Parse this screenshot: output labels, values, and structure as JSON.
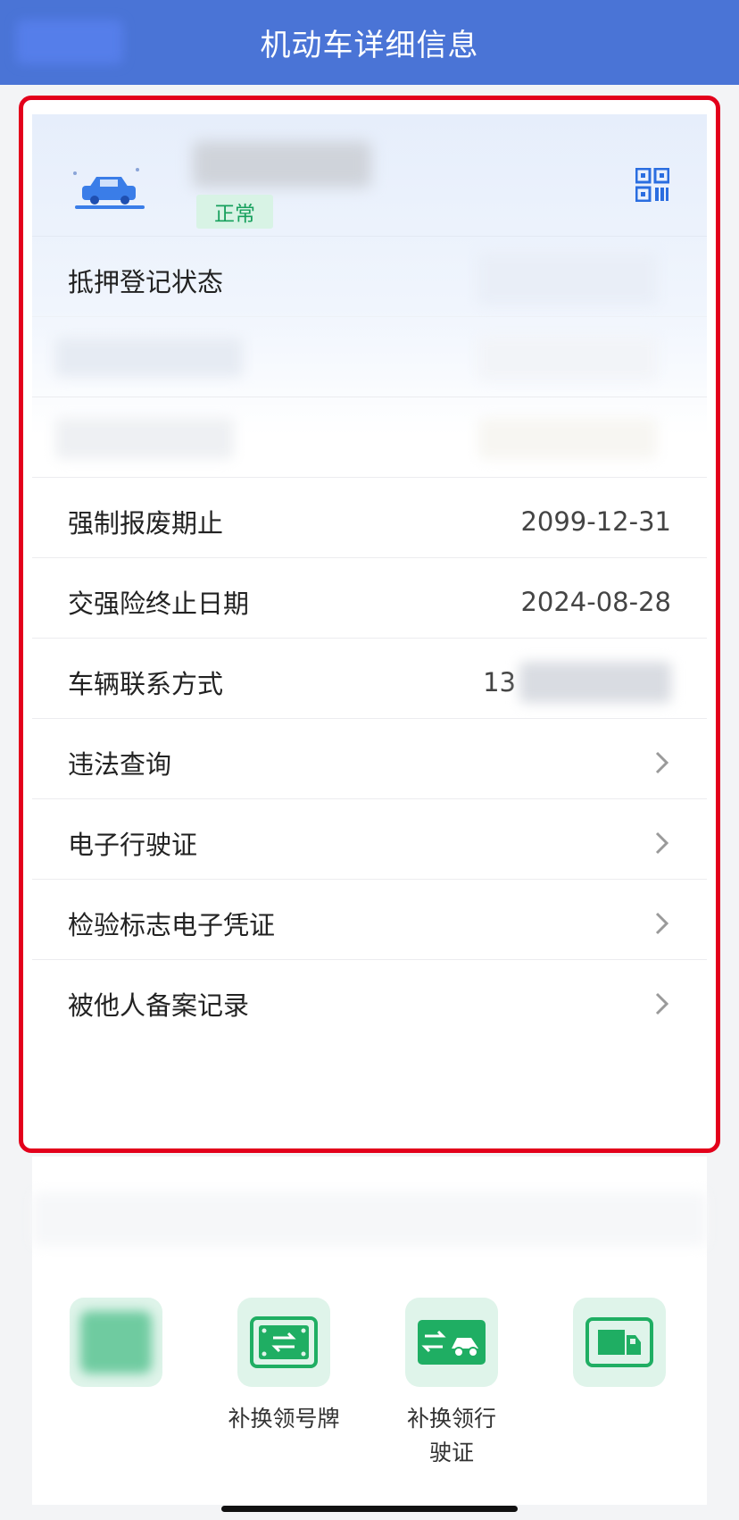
{
  "header": {
    "title": "机动车详细信息"
  },
  "vehicle": {
    "status_badge": "正常"
  },
  "rows": [
    {
      "label": "抵押登记状态",
      "value": ""
    },
    {
      "label": "强制报废期止",
      "value": "2099-12-31"
    },
    {
      "label": "交强险终止日期",
      "value": "2024-08-28"
    },
    {
      "label": "车辆联系方式",
      "value_prefix": "13"
    },
    {
      "label": "违法查询"
    },
    {
      "label": "电子行驶证"
    },
    {
      "label": "检验标志电子凭证"
    },
    {
      "label": "被他人备案记录"
    }
  ],
  "services": [
    {
      "label": ""
    },
    {
      "label": "补换领号牌"
    },
    {
      "label": "补换领行\n驶证"
    },
    {
      "label": ""
    }
  ],
  "colors": {
    "header_bg": "#4a74d6",
    "highlight_border": "#e3001b",
    "status_green": "#17a05d",
    "service_green": "#1fae63"
  },
  "icons": [
    "car-icon",
    "qr-code-icon",
    "chevron-right-icon",
    "license-plate-icon",
    "vehicle-license-icon",
    "truck-icon"
  ]
}
